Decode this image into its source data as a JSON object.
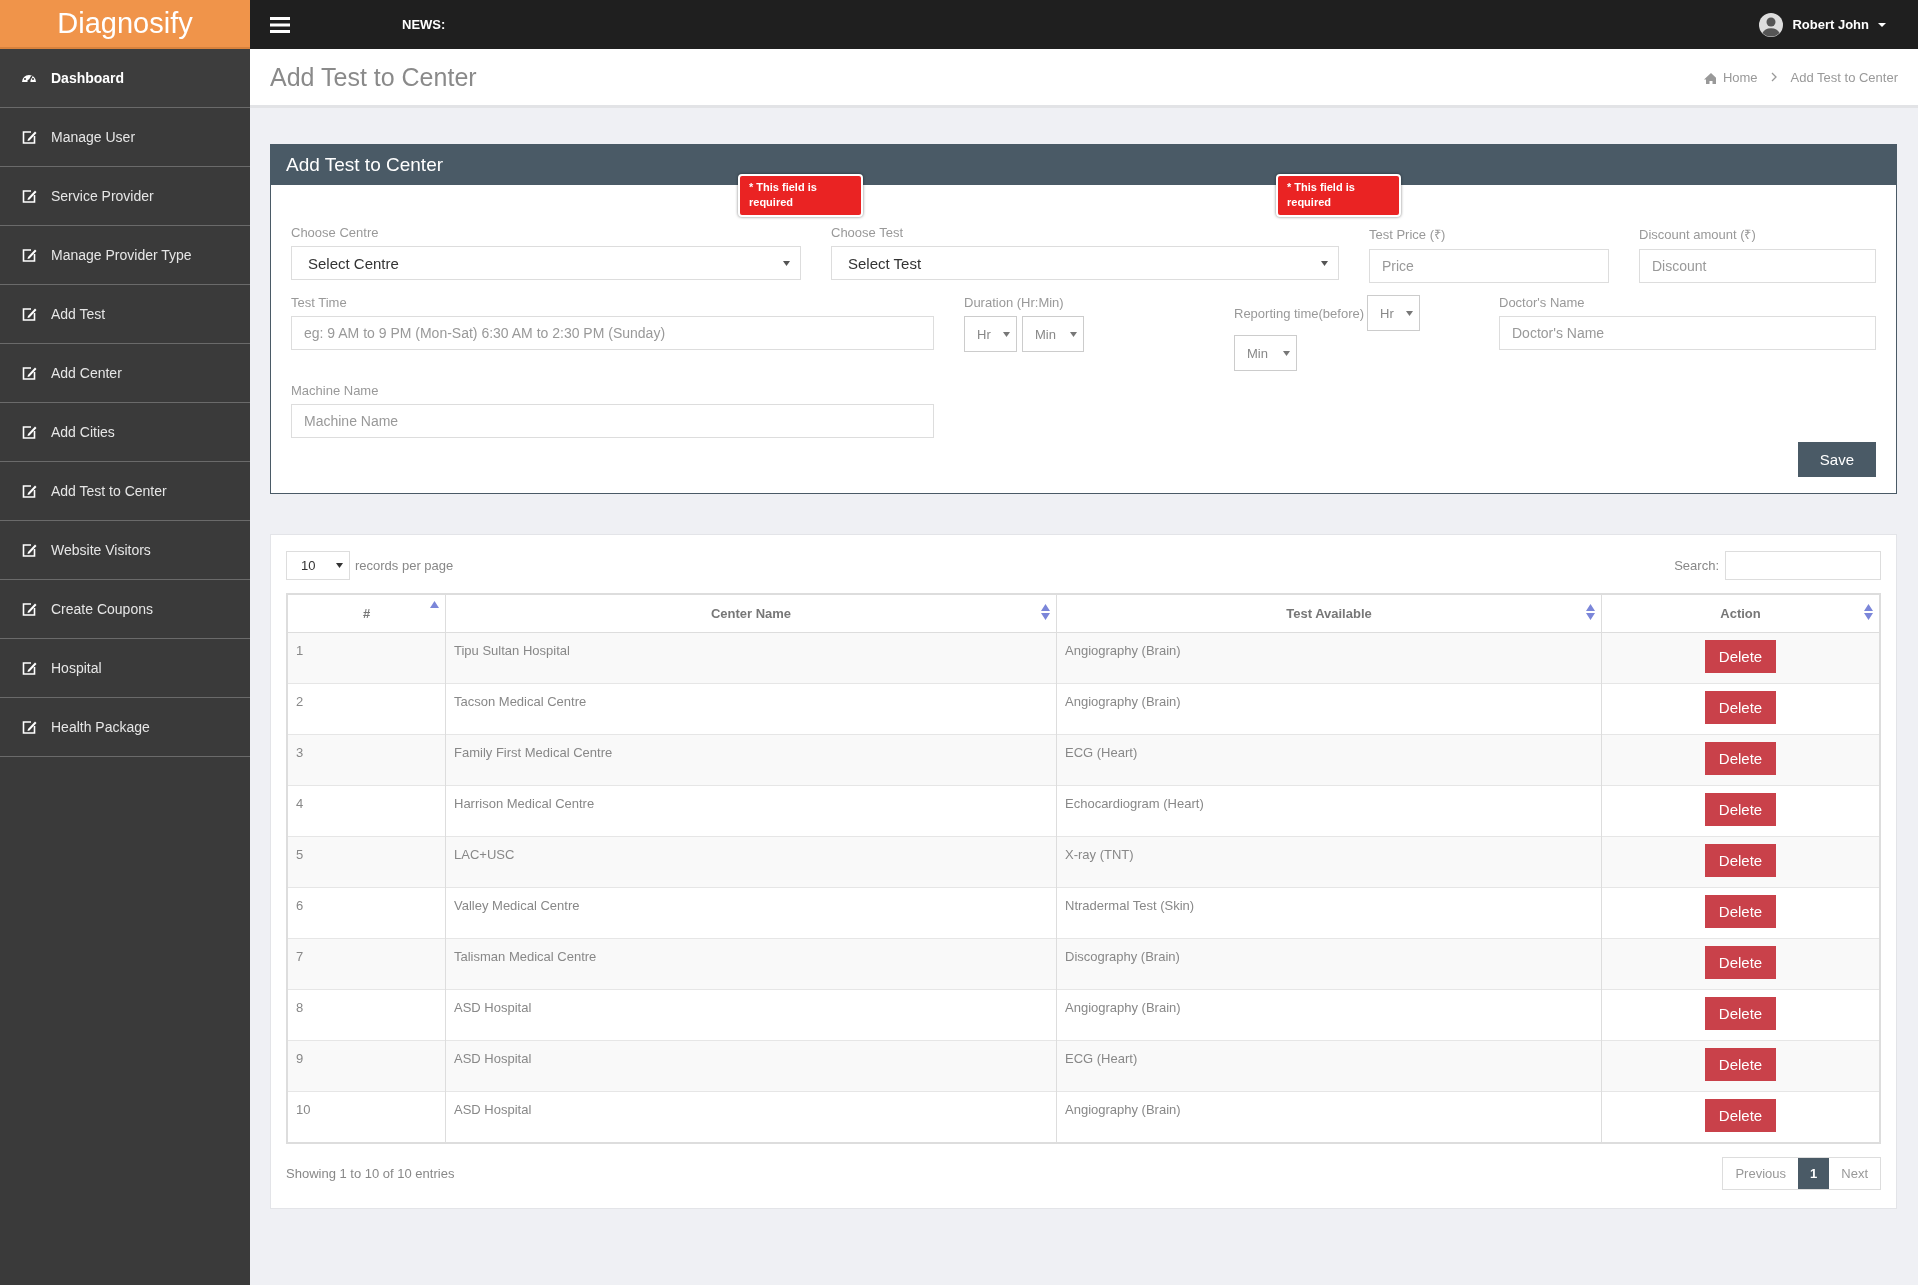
{
  "brand": "Diagnosify",
  "topbar": {
    "news_label": "NEWS:",
    "user": "Robert John"
  },
  "sidebar": {
    "items": [
      {
        "label": "Dashboard",
        "kind": "dashboard",
        "selected": true
      },
      {
        "label": "Manage User",
        "kind": "edit",
        "selected": false
      },
      {
        "label": "Service Provider",
        "kind": "edit",
        "selected": false
      },
      {
        "label": "Manage Provider Type",
        "kind": "edit",
        "selected": false
      },
      {
        "label": "Add Test",
        "kind": "edit",
        "selected": false
      },
      {
        "label": "Add Center",
        "kind": "edit",
        "selected": false
      },
      {
        "label": "Add Cities",
        "kind": "edit",
        "selected": false
      },
      {
        "label": "Add Test to Center",
        "kind": "edit",
        "selected": false
      },
      {
        "label": "Website Visitors",
        "kind": "edit",
        "selected": false
      },
      {
        "label": "Create Coupons",
        "kind": "edit",
        "selected": false
      },
      {
        "label": "Hospital",
        "kind": "edit",
        "selected": false
      },
      {
        "label": "Health Package",
        "kind": "edit",
        "selected": false
      }
    ]
  },
  "page_header": {
    "title": "Add Test to Center",
    "breadcrumb": [
      {
        "label": "Home",
        "kind": "home"
      },
      {
        "label": "Add Test to Center",
        "kind": "current"
      }
    ]
  },
  "form": {
    "title": "Add Test to Center",
    "rows": [
      [
        {
          "kind": "select",
          "label": "Choose Centre",
          "value": "Select Centre",
          "error": "* This field is required"
        },
        {
          "kind": "select",
          "label": "Choose Test",
          "value": "Select Test",
          "error": "* This field is required"
        },
        {
          "kind": "input",
          "label": "Test Price (₹)",
          "placeholder": "Price"
        },
        {
          "kind": "input",
          "label": "Discount amount (₹)",
          "placeholder": "Discount"
        }
      ],
      [
        {
          "kind": "input",
          "label": "Test Time",
          "placeholder": "eg: 9 AM to 9 PM (Mon-Sat) 6:30 AM to 2:30 PM (Sunday)"
        },
        {
          "kind": "pair",
          "label": "Duration (Hr:Min)",
          "values": [
            "Hr",
            "Min"
          ]
        },
        {
          "kind": "inline_pair",
          "label": "Reporting time(before)",
          "values": [
            "Hr",
            "Min"
          ]
        },
        {
          "kind": "input",
          "label": "Doctor's Name",
          "placeholder": "Doctor's Name"
        }
      ],
      [
        {
          "kind": "input",
          "label": "Machine Name",
          "placeholder": "Machine Name"
        }
      ]
    ],
    "save": "Save"
  },
  "table_panel": {
    "length_value": "10",
    "length_label": "records per page",
    "search_label": "Search:",
    "columns": [
      {
        "label": "#",
        "sorted": true
      },
      {
        "label": "Center Name",
        "sorted": false
      },
      {
        "label": "Test Available",
        "sorted": false
      },
      {
        "label": "Action",
        "sorted": false
      }
    ],
    "rows": [
      [
        "1",
        "Tipu Sultan Hospital",
        "Angiography (Brain)",
        "Delete"
      ],
      [
        "2",
        "Tacson Medical Centre",
        "Angiography (Brain)",
        "Delete"
      ],
      [
        "3",
        "Family First Medical Centre",
        "ECG (Heart)",
        "Delete"
      ],
      [
        "4",
        "Harrison Medical Centre",
        "Echocardiogram (Heart)",
        "Delete"
      ],
      [
        "5",
        "LAC+USC",
        "X-ray (TNT)",
        "Delete"
      ],
      [
        "6",
        "Valley Medical Centre",
        "Ntradermal Test (Skin)",
        "Delete"
      ],
      [
        "7",
        "Talisman Medical Centre",
        "Discography (Brain)",
        "Delete"
      ],
      [
        "8",
        "ASD Hospital",
        "Angiography (Brain)",
        "Delete"
      ],
      [
        "9",
        "ASD Hospital",
        "ECG (Heart)",
        "Delete"
      ],
      [
        "10",
        "ASD Hospital",
        "Angiography (Brain)",
        "Delete"
      ]
    ],
    "info": "Showing 1 to 10 of 10 entries",
    "pagination": [
      {
        "label": "Previous",
        "selected": false
      },
      {
        "label": "1",
        "selected": true
      },
      {
        "label": "Next",
        "selected": false
      }
    ]
  }
}
